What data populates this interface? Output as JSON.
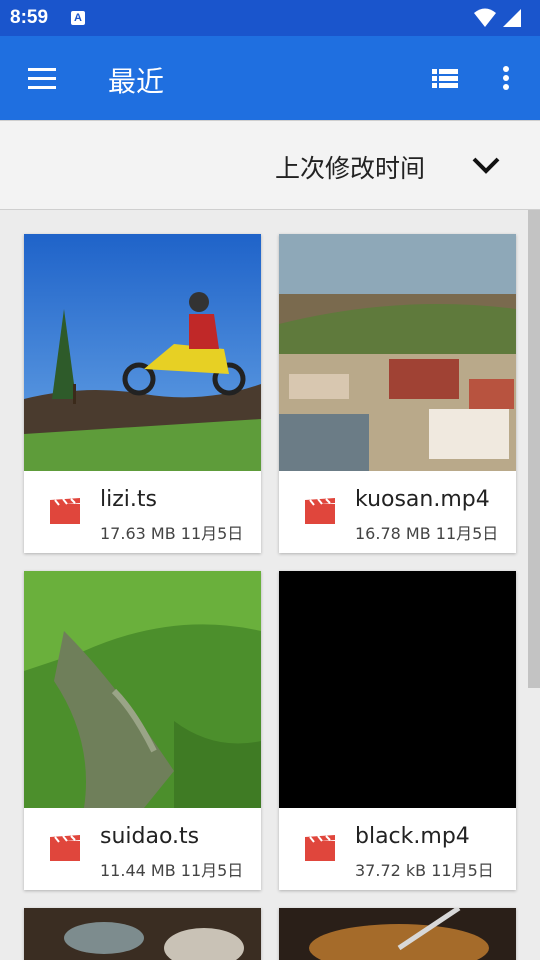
{
  "status_bar": {
    "time": "8:59",
    "notification_icon": "A",
    "icons": [
      "wifi-icon",
      "cell-signal-icon"
    ]
  },
  "app_bar": {
    "title": "最近",
    "icons": [
      "menu-icon",
      "list-view-icon",
      "more-vert-icon"
    ]
  },
  "sort": {
    "label": "上次修改时间",
    "icon": "chevron-down-icon"
  },
  "files": [
    {
      "name": "lizi.ts",
      "meta": "17.63 MB 11月5日",
      "icon": "video-file-icon"
    },
    {
      "name": "kuosan.mp4",
      "meta": "16.78 MB 11月5日",
      "icon": "video-file-icon"
    },
    {
      "name": "suidao.ts",
      "meta": "11.44 MB 11月5日",
      "icon": "video-file-icon"
    },
    {
      "name": "black.mp4",
      "meta": "37.72 kB 11月5日",
      "icon": "video-file-icon"
    }
  ],
  "colors": {
    "status_bar": "#1a55cc",
    "app_bar": "#1f6fe0",
    "file_icon": "#e0463c"
  }
}
